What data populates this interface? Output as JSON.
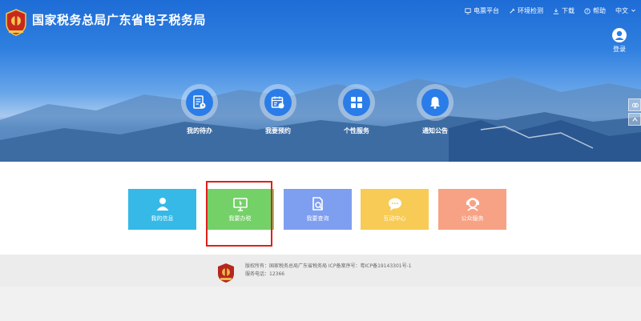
{
  "header": {
    "title": "国家税务总局广东省电子税务局",
    "nav": [
      {
        "label": "电票平台",
        "icon": "monitor-icon"
      },
      {
        "label": "环境检测",
        "icon": "tool-icon"
      },
      {
        "label": "下载",
        "icon": "download-icon"
      },
      {
        "label": "帮助",
        "icon": "help-icon"
      },
      {
        "label": "中文",
        "icon": "chevron-down-icon"
      }
    ],
    "login_label": "登录"
  },
  "quick_circles": [
    {
      "label": "我的待办",
      "icon": "todo-list-icon"
    },
    {
      "label": "我要预约",
      "icon": "calendar-icon"
    },
    {
      "label": "个性服务",
      "icon": "grid-icon"
    },
    {
      "label": "通知公告",
      "icon": "bell-icon"
    }
  ],
  "tiles": [
    {
      "label": "我的信息",
      "icon": "user-icon",
      "color": "#36b9e6"
    },
    {
      "label": "我要办税",
      "icon": "monitor-icon",
      "color": "#74d168"
    },
    {
      "label": "我要查询",
      "icon": "doc-search-icon",
      "color": "#7e9ef0"
    },
    {
      "label": "互动中心",
      "icon": "chat-icon",
      "color": "#f7cb55"
    },
    {
      "label": "公众服务",
      "icon": "public-service-icon",
      "color": "#f8a285"
    }
  ],
  "footer": {
    "line1": "版权所有：国家税务总局广东省税务局    ICP备案序号：粤ICP备19143301号-1",
    "line2": "服务电话：12366"
  },
  "colors": {
    "brand": "#2a7de8",
    "highlight": "#e0201b"
  }
}
